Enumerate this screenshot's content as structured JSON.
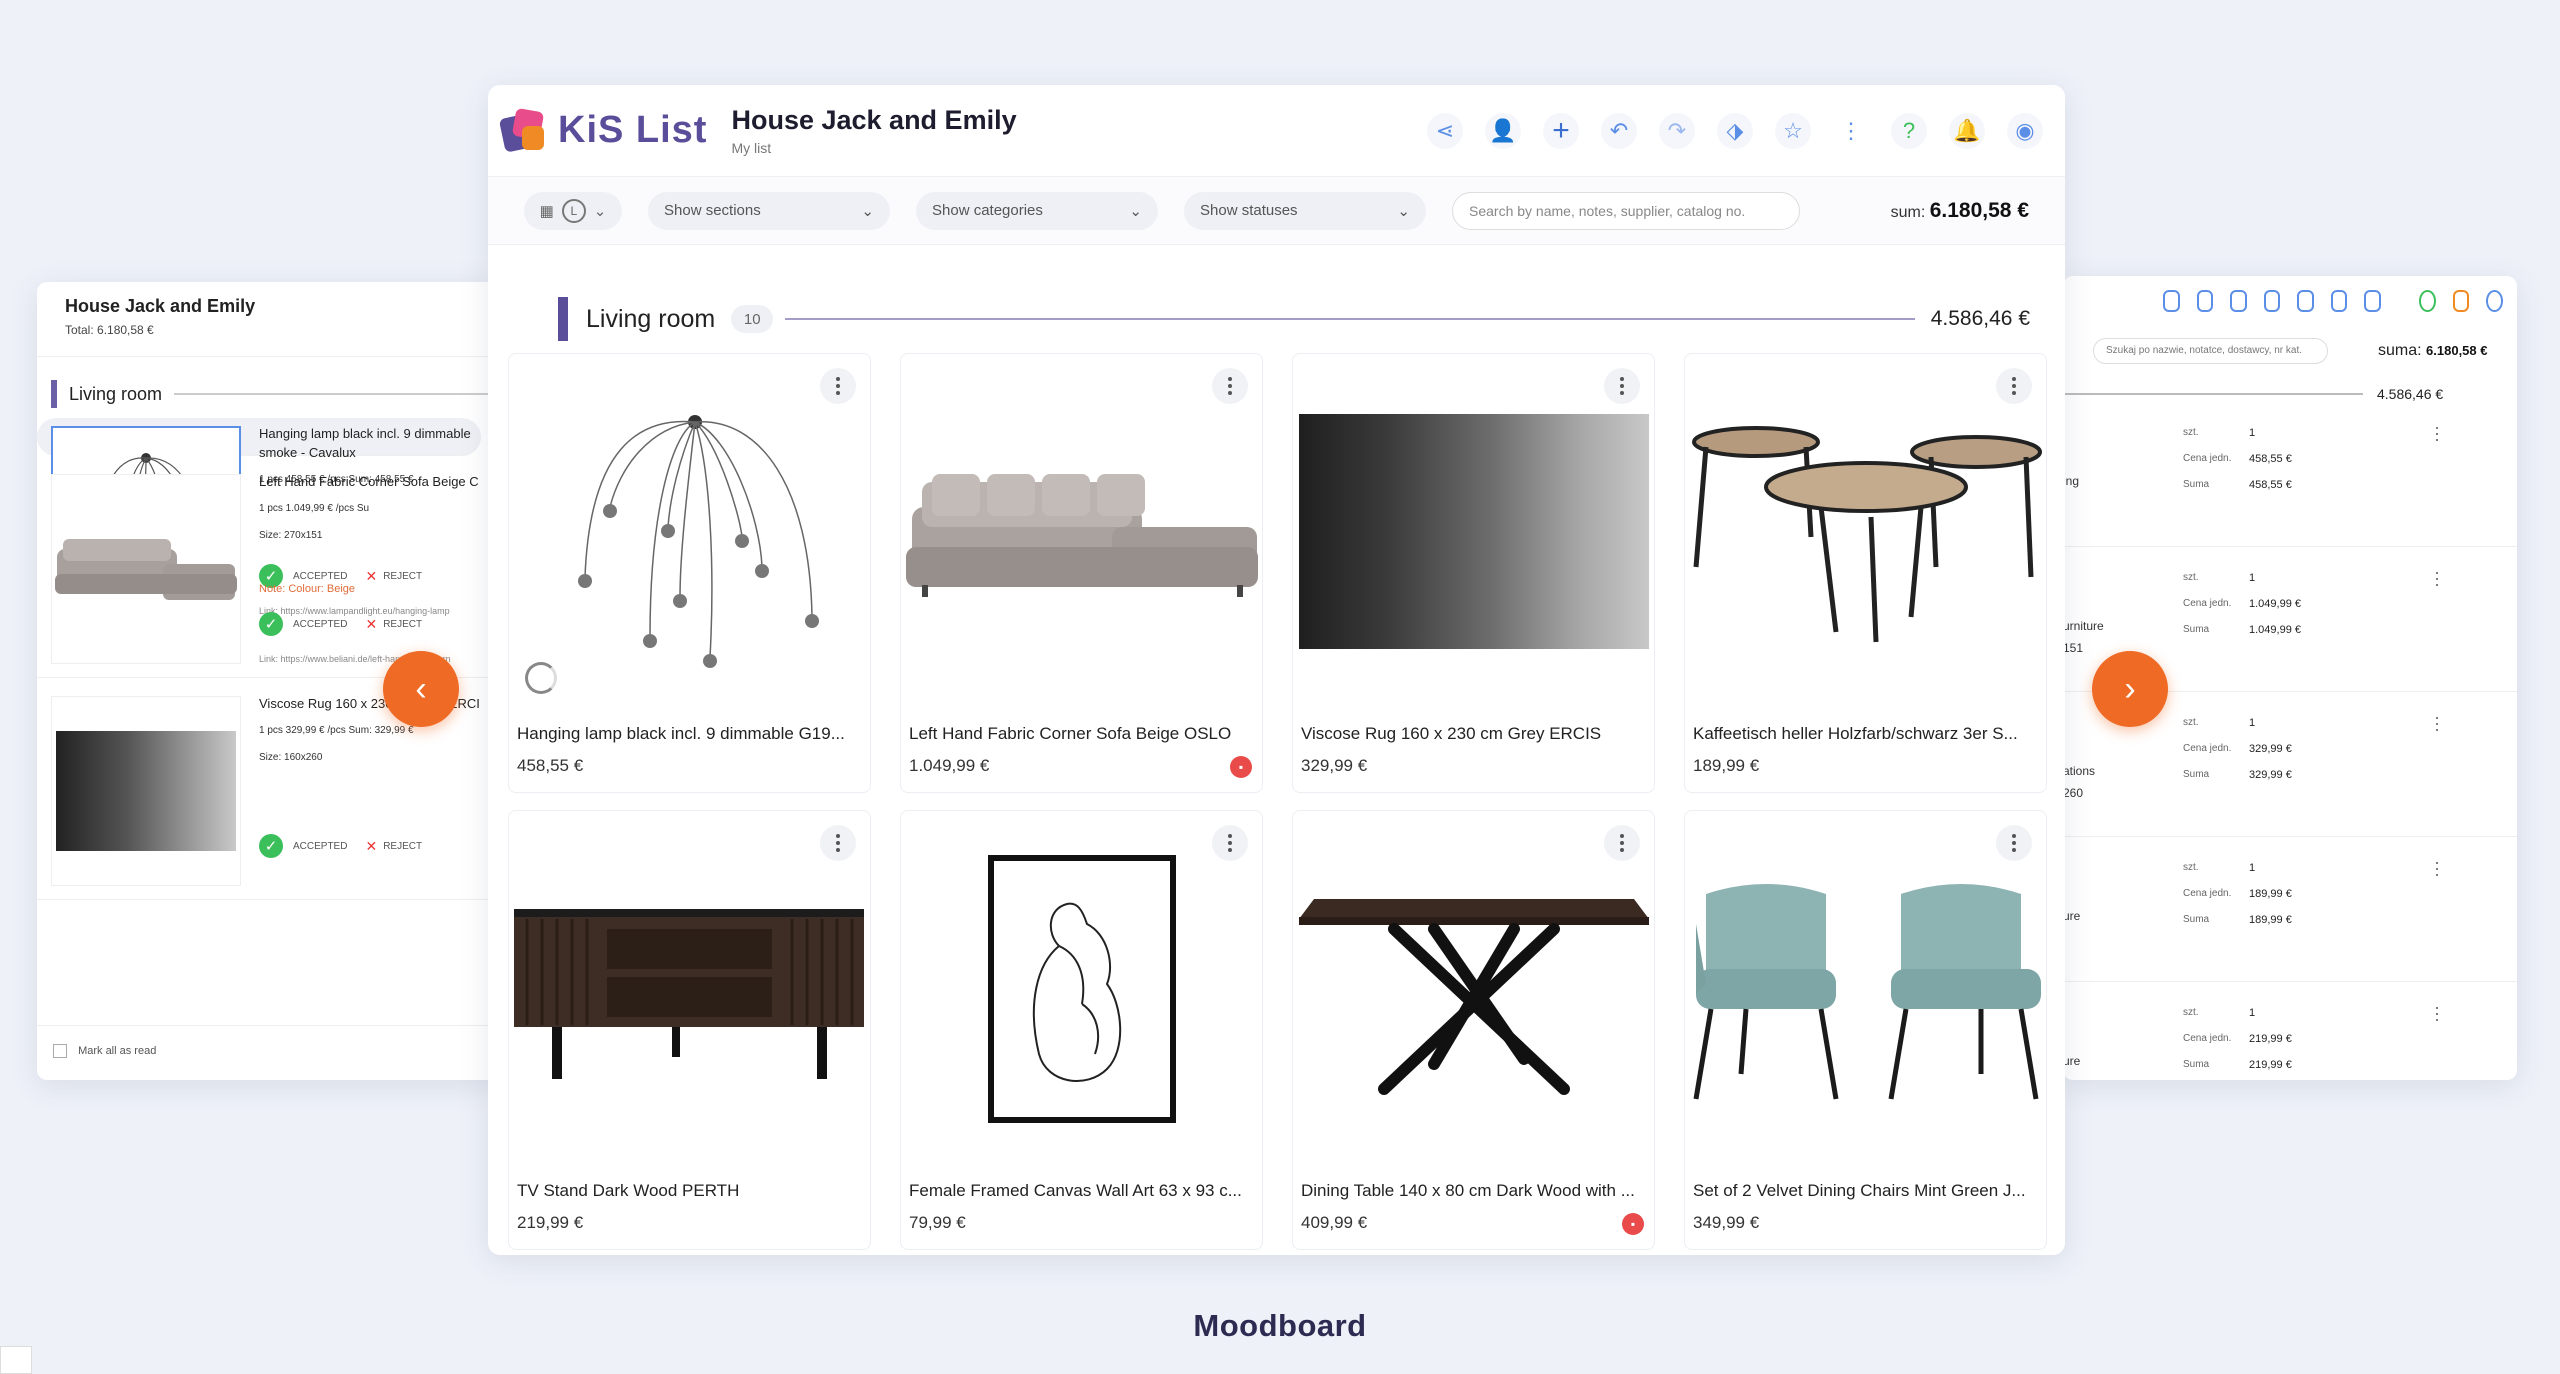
{
  "left_card": {
    "title": "House Jack and Emily",
    "total": "Total: 6.180,58 €",
    "section": "Living room",
    "items": [
      {
        "name": "Hanging lamp black incl. 9 dimmable smoke - Cavalux",
        "meta": "1 pcs  458,55 € /pcs  Sum: 458,55 €",
        "note": "",
        "size": "",
        "link": "Link: https://www.lampandlight.eu/hanging-lamp"
      },
      {
        "name": "Left Hand Fabric Corner Sofa Beige C",
        "meta": "1 pcs  1.049,99 € /pcs  Su",
        "size": "Size: 270x151",
        "note": "Note: Colour: Beige",
        "link": "Link: https://www.beliani.de/left-hand-fabric-corn"
      },
      {
        "name": "Viscose Rug 160 x 230 cm Grey ERCI",
        "meta": "1 pcs  329,99 € /pcs  Sum: 329,99 €",
        "size": "Size: 160x260",
        "note": "",
        "link": ""
      }
    ],
    "accepted_label": "ACCEPTED",
    "reject_label": "REJECT",
    "mark_all": "Mark all as read"
  },
  "right_card": {
    "search_placeholder": "Szukaj po nazwie, notatce, dostawcy, nr kat.",
    "sum_label": "suma:",
    "sum_value": "6.180,58 €",
    "section_total": "4.586,46 €",
    "qty_label": "szt.",
    "unit_label": "Cena jedn.",
    "sum_row_label": "Suma",
    "rows": [
      {
        "frag": "ing",
        "frag2": "",
        "qty": "1",
        "unit": "458,55 €",
        "sum": "458,55 €"
      },
      {
        "frag": "urniture",
        "frag2": "151",
        "qty": "1",
        "unit": "1.049,99 €",
        "sum": "1.049,99 €"
      },
      {
        "frag": "ations",
        "frag2": "260",
        "qty": "1",
        "unit": "329,99 €",
        "sum": "329,99 €"
      },
      {
        "frag": "ure",
        "frag2": "",
        "qty": "1",
        "unit": "189,99 €",
        "sum": "189,99 €"
      },
      {
        "frag": "ure",
        "frag2": "",
        "qty": "1",
        "unit": "219,99 €",
        "sum": "219,99 €"
      }
    ]
  },
  "main": {
    "logo_text": "KiS List",
    "title": "House Jack and Emily",
    "subtitle": "My list",
    "view_label": "L",
    "filters": {
      "sections": "Show sections",
      "categories": "Show categories",
      "statuses": "Show statuses",
      "search_placeholder": "Search by name, notes, supplier, catalog no."
    },
    "sum_label": "sum:",
    "sum_value": "6.180,58 €",
    "section": {
      "name": "Living room",
      "count": "10",
      "total": "4.586,46 €"
    },
    "products": [
      {
        "name": "Hanging lamp black incl. 9 dimmable G19...",
        "price": "458,55 €",
        "img": "lamp",
        "badge": false,
        "spinner": true
      },
      {
        "name": "Left Hand Fabric Corner Sofa Beige OSLO",
        "price": "1.049,99 €",
        "img": "sofa",
        "badge": true,
        "spinner": false
      },
      {
        "name": "Viscose Rug 160 x 230 cm Grey ERCIS",
        "price": "329,99 €",
        "img": "rug",
        "badge": false,
        "spinner": false
      },
      {
        "name": "Kaffeetisch heller Holzfarb/schwarz 3er S...",
        "price": "189,99 €",
        "img": "tables",
        "badge": false,
        "spinner": false
      },
      {
        "name": "TV Stand Dark Wood PERTH",
        "price": "219,99 €",
        "img": "tv",
        "badge": false,
        "spinner": false
      },
      {
        "name": "Female Framed Canvas Wall Art 63 x 93 c...",
        "price": "79,99 €",
        "img": "art",
        "badge": false,
        "spinner": false
      },
      {
        "name": "Dining Table 140 x 80 cm Dark Wood with ...",
        "price": "409,99 €",
        "img": "dtable",
        "badge": true,
        "spinner": false
      },
      {
        "name": "Set of 2 Velvet Dining Chairs Mint Green J...",
        "price": "349,99 €",
        "img": "chairs",
        "badge": false,
        "spinner": false
      }
    ]
  },
  "caption": "Moodboard",
  "colors": {
    "accent": "#5a4d9a",
    "arrow": "#ef6a24",
    "icon": "#5b8ee6",
    "ok": "#3bbf5a"
  }
}
